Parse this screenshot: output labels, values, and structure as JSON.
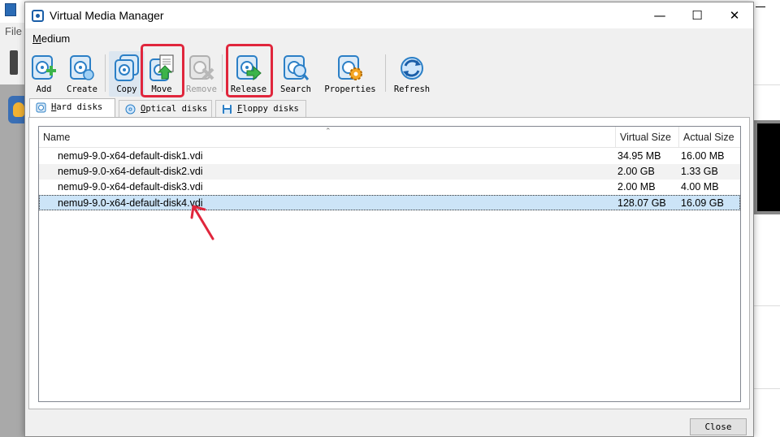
{
  "background_app": {
    "menu_file": "File"
  },
  "dialog": {
    "title": "Virtual Media Manager",
    "menu": {
      "medium": "Medium"
    },
    "toolbar": {
      "add": "Add",
      "create": "Create",
      "copy": "Copy",
      "move": "Move",
      "remove": "Remove",
      "release": "Release",
      "search": "Search",
      "properties": "Properties",
      "refresh": "Refresh"
    },
    "tabs": {
      "hard_disks": "Hard disks",
      "optical_disks": "Optical disks",
      "floppy_disks": "Floppy disks"
    },
    "table": {
      "columns": {
        "name": "Name",
        "virtual_size": "Virtual Size",
        "actual_size": "Actual Size"
      },
      "rows": [
        {
          "name": "nemu9-9.0-x64-default-disk1.vdi",
          "virtual_size": "34.95 MB",
          "actual_size": "16.00 MB"
        },
        {
          "name": "nemu9-9.0-x64-default-disk2.vdi",
          "virtual_size": "2.00 GB",
          "actual_size": "1.33 GB"
        },
        {
          "name": "nemu9-9.0-x64-default-disk3.vdi",
          "virtual_size": "2.00 MB",
          "actual_size": "4.00 MB"
        },
        {
          "name": "nemu9-9.0-x64-default-disk4.vdi",
          "virtual_size": "128.07 GB",
          "actual_size": "16.09 GB"
        }
      ],
      "selected_row": "nemu9-9.0-x64-default-disk4.vdi"
    },
    "close_button": "Close"
  },
  "colors": {
    "highlight": "#e0263c",
    "selection": "#cce4f7",
    "disk_icon_blue": "#2b7fc6",
    "add_green": "#3cb44a"
  }
}
